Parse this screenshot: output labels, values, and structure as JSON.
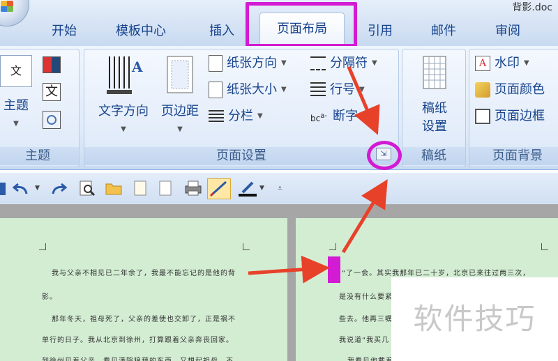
{
  "window": {
    "title": "背影.doc"
  },
  "tabs": [
    "开始",
    "模板中心",
    "插入",
    "页面布局",
    "引用",
    "邮件",
    "审阅"
  ],
  "active_tab": "页面布局",
  "ribbon": {
    "theme_group": {
      "label": "主题",
      "theme_button": "主题",
      "wen_icon_text": "文"
    },
    "page_setup_group": {
      "label": "页面设置",
      "text_direction": "文字方向",
      "margins": "页边距",
      "orientation": "纸张方向",
      "size": "纸张大小",
      "columns": "分栏",
      "breaks": "分隔符",
      "line_numbers": "行号",
      "hyphenation": "断字"
    },
    "manuscript_group": {
      "label": "稿纸",
      "button_line1": "稿纸",
      "button_line2": "设置"
    },
    "page_background_group": {
      "label": "页面背景",
      "watermark": "水印",
      "page_color": "页面颜色",
      "page_borders": "页面边框"
    }
  },
  "document": {
    "left_page_lines": [
      "我与父亲不相见已二年余了，我最不能忘记的是他的背",
      "影。",
      "那年冬天，祖母死了，父亲的差使也交卸了，正是祸不",
      "单行的日子。我从北京到徐州，打算跟着父亲奔丧回家。",
      "到徐州见着父亲，看见满院狼藉的东西，又想起祖母，不"
    ],
    "right_page_lines": [
      "“了一会。其实我那年已二十岁，北京已来往过两三次，",
      "是没有什么要紧",
      "些去。他再三嘱",
      "我说道“我买几",
      "走到那边月台，"
    ],
    "right_partial": "我看见他戴着"
  },
  "watermark_text": "软件技巧",
  "colors": {
    "highlight": "#d21bd2",
    "arrow": "#e8412a",
    "page_bg": "#d3edd3"
  }
}
